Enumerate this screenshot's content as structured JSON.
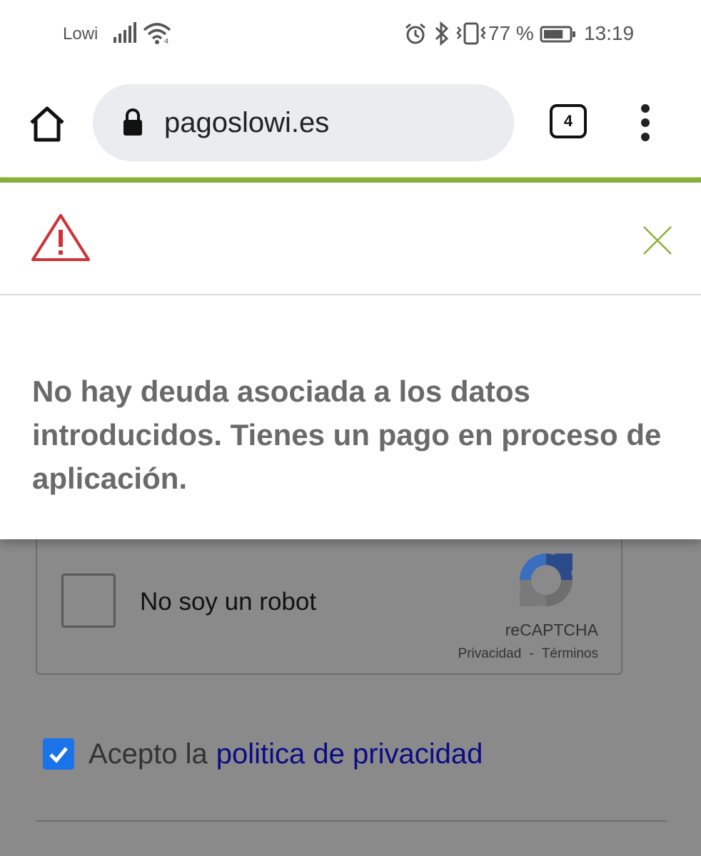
{
  "status_bar": {
    "carrier": "Lowi",
    "battery_percent": "77 %",
    "battery_level": 0.77,
    "time": "13:19",
    "icons": [
      "signal-icon",
      "wifi-icon",
      "alarm-icon",
      "bluetooth-icon",
      "vibrate-icon",
      "battery-icon"
    ]
  },
  "browser": {
    "url": "pagoslowi.es",
    "tab_count": "4",
    "icons": [
      "home-icon",
      "lock-icon",
      "tabs-icon",
      "menu-icon"
    ]
  },
  "dialog": {
    "message": "No hay deuda asociada a los datos introducidos. Tienes un pago en proceso de aplicación.",
    "icons": [
      "warning-icon",
      "close-icon"
    ],
    "colors": {
      "warning": "#d0323a",
      "close": "#8cb23b",
      "accent": "#8cb23b"
    }
  },
  "recaptcha": {
    "label": "No soy un robot",
    "brand": "reCAPTCHA",
    "privacy_link": "Privacidad",
    "separator": "-",
    "terms_link": "Términos",
    "checked": false
  },
  "privacy_consent": {
    "text": "Acepto la",
    "link": "politica de privacidad",
    "checked": true,
    "colors": {
      "checkbox": "#1a73e8",
      "link": "#0b0b86"
    }
  }
}
